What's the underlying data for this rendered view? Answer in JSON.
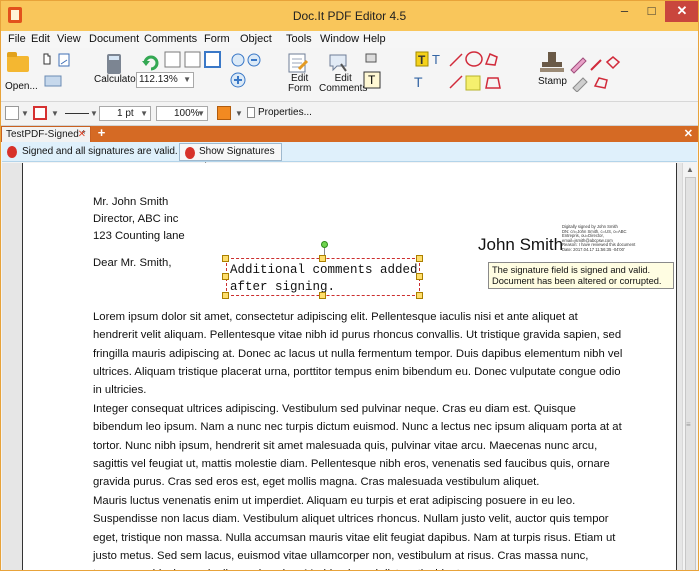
{
  "window": {
    "title": "Doc.It PDF Editor 4.5"
  },
  "menu": [
    "File",
    "Edit",
    "View",
    "Document",
    "Comments",
    "Form",
    "Object",
    "Tools",
    "Window",
    "Help"
  ],
  "toolbar": {
    "open_label": "Open...",
    "calculator_label": "Calculator",
    "zoom_value": "112.13%",
    "edit_form_label": "Edit\nForm",
    "edit_comments_label": "Edit\nComments",
    "stamp_label": "Stamp"
  },
  "format_bar": {
    "line_width": "1 pt",
    "opacity": "100%",
    "properties_label": "Properties..."
  },
  "tabs": {
    "active": "TestPDF-Signed *"
  },
  "signature_banner": {
    "message": "Signed and all signatures are valid.",
    "show_button": "Show Signatures List"
  },
  "document": {
    "address": [
      "Mr. John Smith",
      "Director, ABC inc",
      "123 Counting lane"
    ],
    "salutation": "Dear Mr. Smith,",
    "annotation_lines": [
      "Additional comments added",
      "after signing."
    ],
    "signature_name": "John Smith",
    "signature_details": "Digitally signed by John Smith\nDN: cn=John Smith, c=US, o=ABC\nEntrepris, ou=Director,\nemail=jsmith@abcpsw.com\nReason: I have reviewed this document\nDate: 2017.04.17 11:56:35 -04'00'",
    "tooltip": "The signature field is signed and valid.\nDocument has been altered or corrupted.",
    "paragraph_1": "Lorem ipsum dolor sit amet, consectetur adipiscing elit. Pellentesque iaculis nisi et ante aliquet at hendrerit velit aliquam. Pellentesque vitae nibh id purus rhoncus convallis. Ut tristique gravida sapien, sed fringilla mauris adipiscing at. Donec ac lacus ut nulla fermentum tempor. Duis dapibus elementum nibh vel ultrices. Aliquam tristique placerat urna, porttitor tempus enim bibendum eu. Donec vulputate congue odio in ultricies.",
    "paragraph_2": "Integer consequat ultrices adipiscing. Vestibulum sed pulvinar neque. Cras eu diam est. Quisque bibendum leo ipsum. Nam a nunc nec turpis dictum euismod. Nunc a lectus nec ipsum aliquam porta at at tortor. Nunc nibh ipsum, hendrerit sit amet malesuada quis, pulvinar vitae arcu. Maecenas nunc arcu, sagittis vel feugiat ut, mattis molestie diam. Pellentesque nibh eros, venenatis sed faucibus quis, ornare gravida purus. Cras sed eros est, eget mollis magna. Cras malesuada vestibulum aliquet.",
    "paragraph_3": "Mauris luctus venenatis enim ut imperdiet. Aliquam eu turpis et erat adipiscing posuere in eu leo. Suspendisse non lacus diam. Vestibulum aliquet ultrices rhoncus. Nullam justo velit, auctor quis tempor eget, tristique non massa. Nulla accumsan mauris vitae elit feugiat dapibus. Nam at turpis risus. Etiam ut justo metus. Sed sem lacus, euismod vitae ullamcorper non, vestibulum at risus. Cras massa nunc, tempor a vehicula eu, dapibus vel sapien. Morbi euismod dictum tincidunt."
  },
  "colors": {
    "titlebar": "#f9c65b",
    "tabbar": "#d56a24",
    "banner": "#dff0fb",
    "close": "#c9463d"
  }
}
